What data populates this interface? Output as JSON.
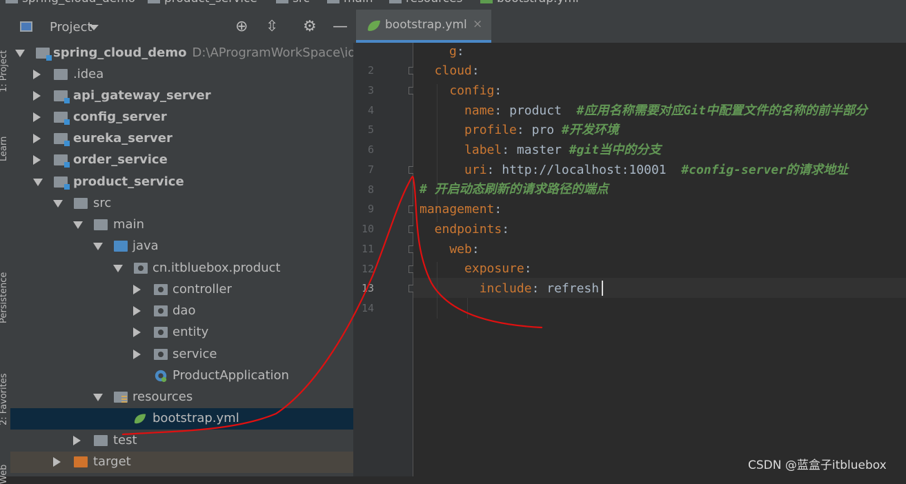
{
  "breadcrumb": [
    "spring_cloud_demo",
    "product_service",
    "src",
    "main",
    "resources",
    "bootstrap.yml"
  ],
  "side_strip": [
    "1: Project",
    "Learn",
    "Persistence",
    "2: Favorites",
    "Web"
  ],
  "project_panel": {
    "title": "Project",
    "icons": [
      "crosshair-icon",
      "collapse-icon",
      "gear-icon",
      "minimize-icon"
    ]
  },
  "tree": [
    {
      "label": "spring_cloud_demo",
      "path": "D:\\AProgramWorkSpace\\idea\\spring_cloud_demo",
      "state": "open"
    },
    {
      "label": ".idea",
      "state": "closed"
    },
    {
      "label": "api_gateway_server",
      "state": "closed"
    },
    {
      "label": "config_server",
      "state": "closed"
    },
    {
      "label": "eureka_server",
      "state": "closed"
    },
    {
      "label": "order_service",
      "state": "closed"
    },
    {
      "label": "product_service",
      "state": "open"
    },
    {
      "label": "src",
      "state": "open"
    },
    {
      "label": "main",
      "state": "open"
    },
    {
      "label": "java",
      "state": "open"
    },
    {
      "label": "cn.itbluebox.product",
      "state": "open"
    },
    {
      "label": "controller",
      "state": "closed"
    },
    {
      "label": "dao",
      "state": "closed"
    },
    {
      "label": "entity",
      "state": "closed"
    },
    {
      "label": "service",
      "state": "closed"
    },
    {
      "label": "ProductApplication",
      "state": "leaf"
    },
    {
      "label": "resources",
      "state": "open"
    },
    {
      "label": "bootstrap.yml",
      "state": "leaf",
      "selected": true
    },
    {
      "label": "test",
      "state": "closed"
    },
    {
      "label": "target",
      "state": "closed"
    }
  ],
  "editor": {
    "tab": "bootstrap.yml",
    "close": "×",
    "line_numbers": [
      "2",
      "3",
      "4",
      "5",
      "6",
      "7",
      "8",
      "9",
      "10",
      "11",
      "12",
      "13",
      "14"
    ],
    "current_line": "13",
    "lines": [
      {
        "k": "g",
        "p": ":"
      },
      {
        "k": "  cloud",
        "p": ":"
      },
      {
        "k": "    config",
        "p": ":"
      },
      {
        "k": "      name",
        "p": ": ",
        "v": "product  ",
        "c": "#应用名称需要对应Git中配置文件的名称的前半部分"
      },
      {
        "k": "      profile",
        "p": ": ",
        "v": "pro ",
        "c": "#开发环境"
      },
      {
        "k": "      label",
        "p": ": ",
        "v": "master ",
        "c": "#git当中的分支"
      },
      {
        "k": "      uri",
        "p": ": ",
        "v": "http://localhost:10001  ",
        "c": "#config-server的请求地址"
      },
      {
        "c": "# 开启动态刷新的请求路径的端点"
      },
      {
        "k": "management",
        "p": ":"
      },
      {
        "k": "  endpoints",
        "p": ":"
      },
      {
        "k": "    web",
        "p": ":"
      },
      {
        "k": "      exposure",
        "p": ":"
      },
      {
        "k": "        include",
        "p": ": ",
        "v": "refresh"
      }
    ]
  },
  "watermark": "CSDN @蓝盒子itbluebox",
  "colors": {
    "keyword": "#cc7832",
    "comment": "#629755",
    "selection": "#0d293e",
    "accent": "#4a88c7"
  }
}
